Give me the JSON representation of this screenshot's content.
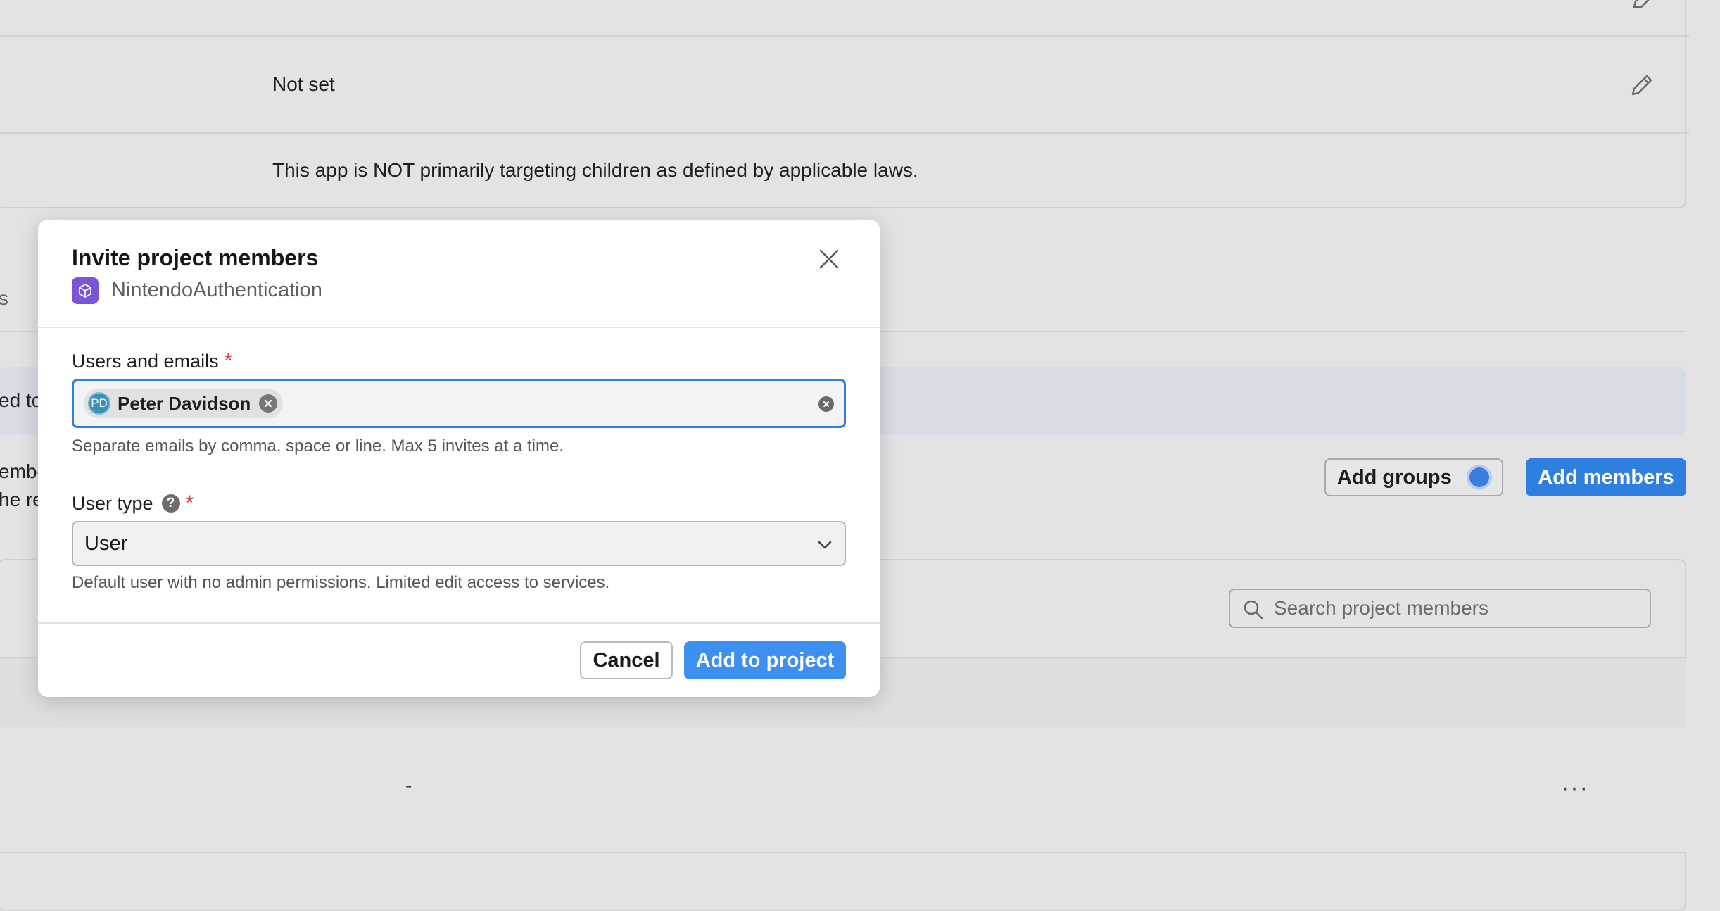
{
  "background": {
    "row_age_value": "Not set",
    "row_children_text": "This app is NOT primarily targeting children as defined by applicable laws.",
    "tab_fragment": "s",
    "notice_fragment": "ed to",
    "desc_fragment_1": "embe",
    "desc_fragment_2": "he re",
    "add_groups_label": "Add groups",
    "add_members_label": "Add members",
    "search_placeholder": "Search project members",
    "row_dash": "-",
    "row_more": "···"
  },
  "modal": {
    "title": "Invite project members",
    "project_name": "NintendoAuthentication",
    "users_label": "Users and emails",
    "required_mark": "*",
    "chips": [
      {
        "initials": "PD",
        "name": "Peter Davidson"
      }
    ],
    "users_hint": "Separate emails by comma, space or line. Max 5 invites at a time.",
    "user_type_label": "User type",
    "help_mark": "?",
    "user_type_value": "User",
    "user_type_hint": "Default user with no admin permissions. Limited edit access to services.",
    "cancel_label": "Cancel",
    "submit_label": "Add to project"
  },
  "colors": {
    "accent": "#2f7fe0",
    "project_icon": "#7a55d6",
    "required": "#d83a3a"
  },
  "icons": [
    "pencil-icon",
    "cube-icon",
    "close-icon",
    "clear-icon",
    "help-icon",
    "chevron-down-icon",
    "search-icon",
    "more-icon"
  ]
}
